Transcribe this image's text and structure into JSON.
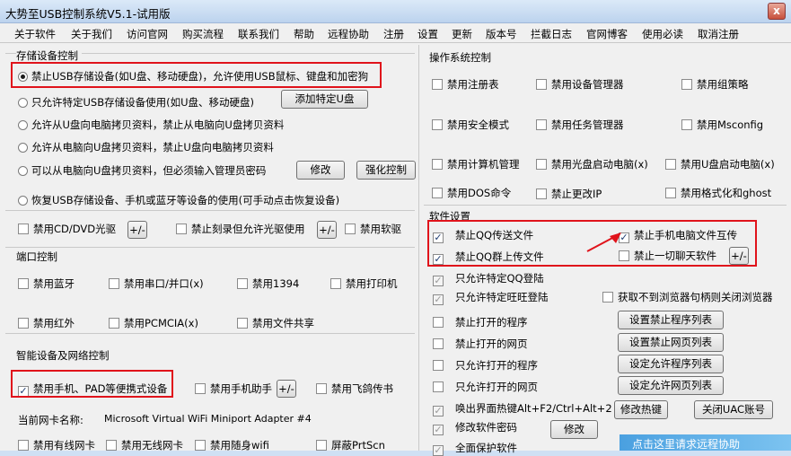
{
  "window": {
    "title": "大势至USB控制系统V5.1-试用版",
    "close": "x"
  },
  "menu": [
    "关于软件",
    "关于我们",
    "访问官网",
    "购买流程",
    "联系我们",
    "帮助",
    "远程协助",
    "注册",
    "设置",
    "更新",
    "版本号",
    "拦截日志",
    "官网博客",
    "使用必读",
    "取消注册"
  ],
  "usb": {
    "title": "存储设备控制",
    "opt1": "禁止USB存储设备(如U盘、移动硬盘)，允许使用USB鼠标、键盘和加密狗",
    "opt2": "只允许特定USB存储设备使用(如U盘、移动硬盘)",
    "add_btn": "添加特定U盘",
    "opt3": "允许从U盘向电脑拷贝资料，禁止从电脑向U盘拷贝资料",
    "opt4": "允许从电脑向U盘拷贝资料，禁止U盘向电脑拷贝资料",
    "opt5": "可以从电脑向U盘拷贝资料，但必须输入管理员密码",
    "modify_btn": "修改",
    "harden_btn": "强化控制",
    "opt6": "恢复USB存储设备、手机或蓝牙等设备的使用(可手动点击恢复设备)",
    "cd": "禁用CD/DVD光驱",
    "plus": "+/-",
    "burn": "禁止刻录但允许光驱使用",
    "floppy": "禁用软驱"
  },
  "port": {
    "title": "端口控制",
    "bluetooth": "禁用蓝牙",
    "serial": "禁用串口/并口(x)",
    "p1394": "禁用1394",
    "printer": "禁用打印机",
    "infrared": "禁用红外",
    "pcmcia": "禁用PCMCIA(x)",
    "share": "禁用文件共享"
  },
  "smart": {
    "title": "智能设备及网络控制",
    "phone": "禁用手机、PAD等便携式设备",
    "assistant": "禁用手机助手",
    "plus": "+/-",
    "feige": "禁用飞鸽传书",
    "nic_label": "当前网卡名称:",
    "nic_value": "Microsoft Virtual WiFi Miniport Adapter #4",
    "wired": "禁用有线网卡",
    "wireless": "禁用无线网卡",
    "portable_wifi": "禁用随身wifi",
    "prtscn": "屏蔽PrtScn"
  },
  "os": {
    "title": "操作系统控制",
    "regedit": "禁用注册表",
    "devmgr": "禁用设备管理器",
    "gpedit": "禁用组策略",
    "safemode": "禁用安全模式",
    "taskmgr": "禁用任务管理器",
    "msconfig": "禁用Msconfig",
    "compmgmt": "禁用计算机管理",
    "cdboot": "禁用光盘启动电脑(x)",
    "uboot": "禁用U盘启动电脑(x)",
    "dos": "禁用DOS命令",
    "ip": "禁止更改IP",
    "format": "禁用格式化和ghost"
  },
  "soft": {
    "title": "软件设置",
    "qq_file": "禁止QQ传送文件",
    "phone_pc": "禁止手机电脑文件互传",
    "qq_group": "禁止QQ群上传文件",
    "chat": "禁止一切聊天软件",
    "plus": "+/-",
    "qq_login": "只允许特定QQ登陆",
    "ww_login": "只允许特定旺旺登陆",
    "browser": "获取不到浏览器句柄则关闭浏览器",
    "block_prog": "禁止打开的程序",
    "block_prog_btn": "设置禁止程序列表",
    "block_web": "禁止打开的网页",
    "block_web_btn": "设置禁止网页列表",
    "allow_prog": "只允许打开的程序",
    "allow_prog_btn": "设定允许程序列表",
    "allow_web": "只允许打开的网页",
    "allow_web_btn": "设定允许网页列表",
    "hotkey": "唤出界面热键Alt+F2/Ctrl+Alt+2",
    "hotkey_btn": "修改热键",
    "uac_btn": "关闭UAC账号",
    "pwd": "修改软件密码",
    "pwd_btn": "修改",
    "protect": "全面保护软件"
  },
  "overlay_text": "点击这里请求远程协助",
  "colors": {
    "highlight": "#e0131b",
    "check": "#1d3b70"
  }
}
